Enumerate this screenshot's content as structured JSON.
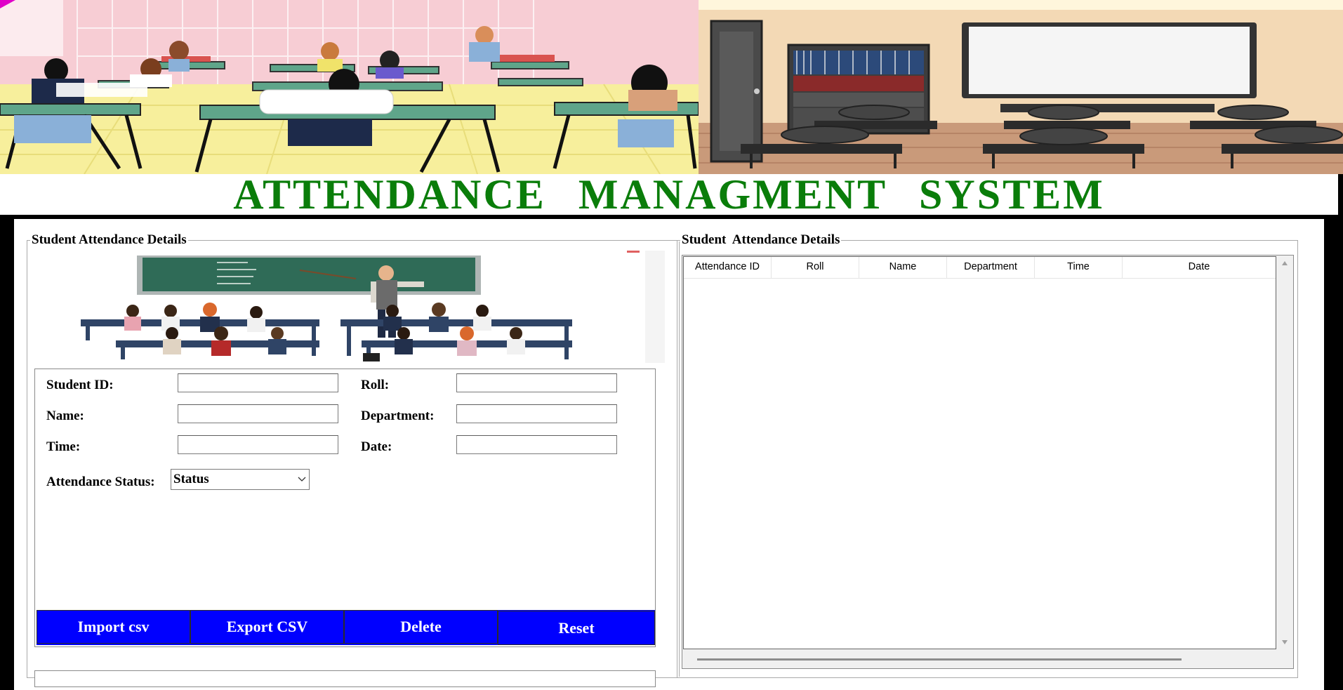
{
  "app": {
    "title": "ATTENDANCE   MANAGMENT   SYSTEM"
  },
  "left_panel": {
    "title": "Student Attendance Details",
    "form": {
      "student_id_label": "Student ID:",
      "roll_label": "Roll:",
      "name_label": "Name:",
      "department_label": "Department:",
      "time_label": "Time:",
      "date_label": "Date:",
      "attendance_status_label": "Attendance Status:",
      "student_id_value": "",
      "roll_value": "",
      "name_value": "",
      "department_value": "",
      "time_value": "",
      "date_value": "",
      "status_selected": "Status"
    },
    "buttons": {
      "import_label": "Import csv",
      "export_label": "Export CSV",
      "delete_label": "Delete",
      "reset_label": "Reset"
    }
  },
  "right_panel": {
    "title": "Student  Attendance Details",
    "table": {
      "columns": [
        "Attendance ID",
        "Roll",
        "Name",
        "Department",
        "Time",
        "Date"
      ],
      "rows": []
    }
  },
  "colors": {
    "title_green": "#0a7d0a",
    "button_blue": "#0000ff",
    "background_black": "#000000"
  }
}
